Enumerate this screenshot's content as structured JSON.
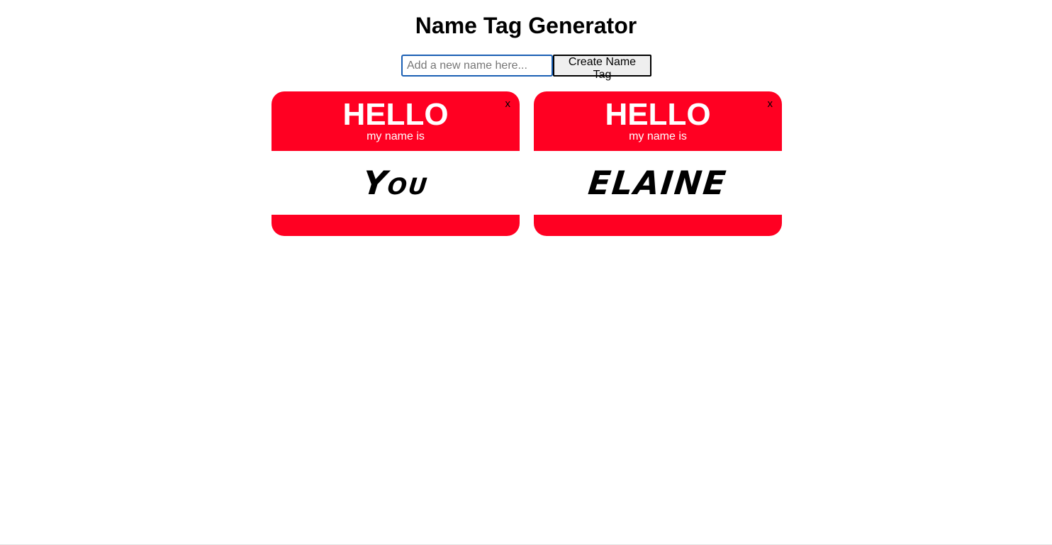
{
  "header": {
    "title": "Name Tag Generator"
  },
  "form": {
    "input_value": "",
    "input_placeholder": "Add a new name here...",
    "button_label": "Create Name Tag"
  },
  "tags": [
    {
      "hello": "HELLO",
      "subtitle": "my name is",
      "close_label": "x",
      "name": "You"
    },
    {
      "hello": "HELLO",
      "subtitle": "my name is",
      "close_label": "x",
      "name": "ELAINE"
    }
  ],
  "colors": {
    "tag_red": "#ff0022",
    "input_focus_border": "#1a5fb4"
  }
}
